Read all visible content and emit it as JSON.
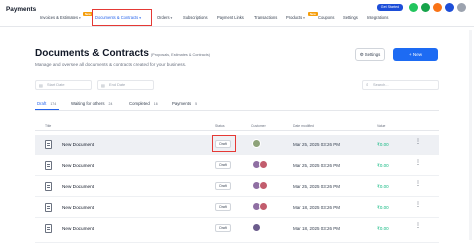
{
  "app": {
    "title": "Payments"
  },
  "nav": {
    "items": [
      {
        "label": "Invoices & Estimates",
        "chevron": true,
        "badge": "New"
      },
      {
        "label": "Documents & Contracts",
        "chevron": true,
        "active": true
      },
      {
        "label": "Orders",
        "chevron": true
      },
      {
        "label": "Subscriptions"
      },
      {
        "label": "Payment Links"
      },
      {
        "label": "Transactions"
      },
      {
        "label": "Products",
        "chevron": true,
        "badge": "New"
      },
      {
        "label": "Coupons"
      },
      {
        "label": "Settings"
      },
      {
        "label": "Integrations"
      }
    ],
    "get_started": "Get Started",
    "icon_colors": [
      "#22c55e",
      "#16a34a",
      "#f97316",
      "#1d4ed8",
      "#9ca3af"
    ]
  },
  "header": {
    "title": "Documents & Contracts",
    "subtitle": "(Proposals, Estimates & Contracts)",
    "description": "Manage and oversee all documents & contracts created for your business.",
    "settings_label": "Settings",
    "new_label": "New",
    "new_prefix": "+"
  },
  "filters": {
    "start_date_placeholder": "Start Date",
    "end_date_placeholder": "End Date",
    "search_placeholder": "Search..."
  },
  "status_tabs": [
    {
      "label": "Draft",
      "count": "174",
      "active": true
    },
    {
      "label": "Waiting for others",
      "count": "24"
    },
    {
      "label": "Completed",
      "count": "16"
    },
    {
      "label": "Payments",
      "count": "5"
    }
  ],
  "table": {
    "headers": [
      "Title",
      "Status",
      "Customer",
      "Date modified",
      "Value"
    ],
    "rows": [
      {
        "title": "New Document",
        "status": "Draft",
        "date": "Mar 25, 2025 03:26 PM",
        "value": "₹0.00",
        "avatars": [
          "#8ea37a"
        ],
        "highlight": true
      },
      {
        "title": "New Document",
        "status": "Draft",
        "date": "Mar 25, 2025 03:26 PM",
        "value": "₹0.00",
        "avatars": [
          "#8f6fa3",
          "#c25d6d"
        ]
      },
      {
        "title": "New Document",
        "status": "Draft",
        "date": "Mar 25, 2025 03:26 PM",
        "value": "₹0.00",
        "avatars": [
          "#8f6fa3",
          "#c25d6d"
        ]
      },
      {
        "title": "New Document",
        "status": "Draft",
        "date": "Mar 18, 2025 03:26 PM",
        "value": "₹0.00",
        "avatars": [
          "#8f6fa3",
          "#c25d6d"
        ]
      },
      {
        "title": "New Document",
        "status": "Draft",
        "date": "Mar 18, 2025 03:26 PM",
        "value": "₹0.00",
        "avatars": [
          "#6b5c8c"
        ]
      }
    ]
  },
  "colors": {
    "accent": "#2563eb",
    "value_green": "#10b981",
    "highlight_red": "#e53935"
  }
}
